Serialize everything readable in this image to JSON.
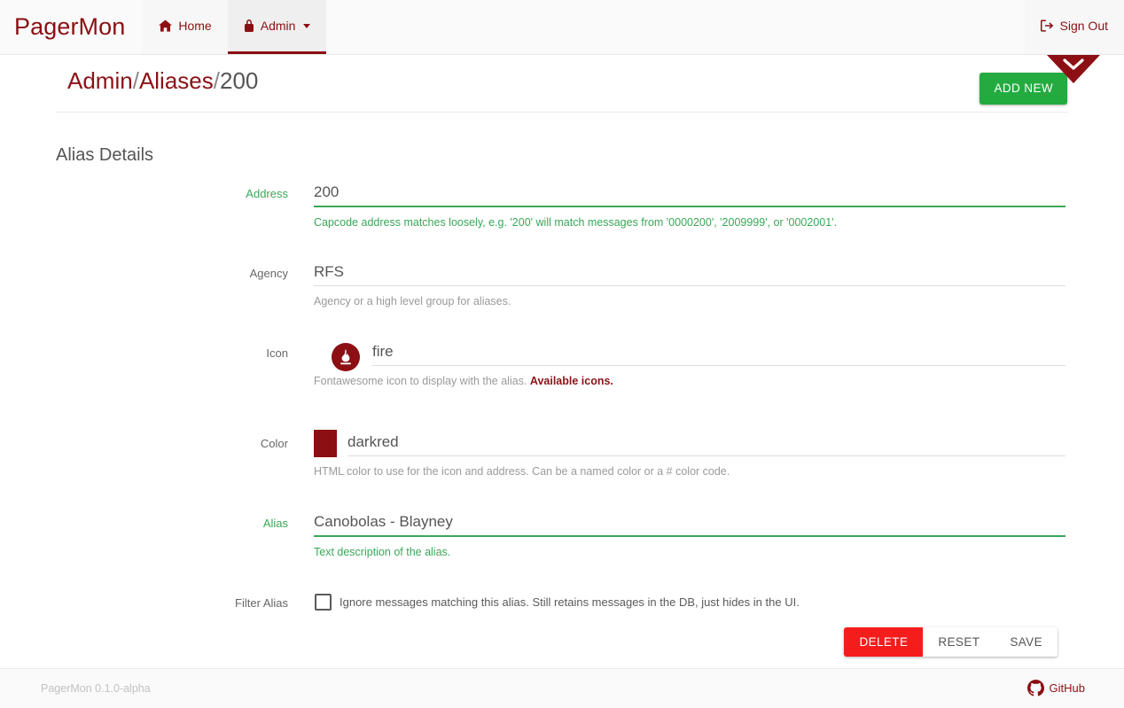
{
  "navbar": {
    "brand": "PagerMon",
    "items": [
      {
        "label": "Home",
        "icon": "home-icon",
        "active": false
      },
      {
        "label": "Admin",
        "icon": "lock-icon",
        "active": true,
        "caret": true
      }
    ],
    "sign_out": {
      "label": "Sign Out",
      "icon": "sign-out-icon"
    }
  },
  "indicator": {
    "icon": "chevron-down-icon",
    "color": "#8b0f13"
  },
  "header": {
    "breadcrumb": {
      "root": "Admin",
      "section": "Aliases",
      "current": "200",
      "separator": "/"
    },
    "add_new_label": "ADD NEW"
  },
  "form": {
    "title": "Alias Details",
    "fields": [
      {
        "label": "Address",
        "value": "200",
        "help": "Capcode address matches loosely, e.g. '200' will match messages from '0000200', '2009999', or '0002001'.",
        "state": "valid"
      },
      {
        "label": "Agency",
        "value": "RFS",
        "help": "Agency or a high level group for aliases.",
        "state": "normal"
      },
      {
        "label": "Icon",
        "value": "fire",
        "help": "Fontawesome icon to display with the alias.",
        "help_link": "Available icons.",
        "state": "normal",
        "preview_icon": "fire-icon",
        "preview_color": "#8b0f13"
      },
      {
        "label": "Color",
        "value": "darkred",
        "help": "HTML color to use for the icon and address. Can be a named color or a # color code.",
        "state": "normal",
        "swatch_color": "#8b0f13"
      },
      {
        "label": "Alias",
        "value": "Canobolas - Blayney",
        "help": "Text description of the alias.",
        "state": "valid"
      }
    ],
    "filter": {
      "label": "Filter Alias",
      "checkbox_label": "Ignore messages matching this alias. Still retains messages in the DB, just hides in the UI.",
      "checked": false
    },
    "buttons": {
      "delete": "DELETE",
      "reset": "RESET",
      "save": "SAVE"
    }
  },
  "footer": {
    "version": "PagerMon 0.1.0-alpha",
    "github_label": "GitHub",
    "github_icon": "github-icon"
  },
  "colors": {
    "brand_red": "#8b0f13",
    "success_green": "#3aa757",
    "add_new_green": "#23ab40",
    "delete_red": "#f51c1c"
  }
}
